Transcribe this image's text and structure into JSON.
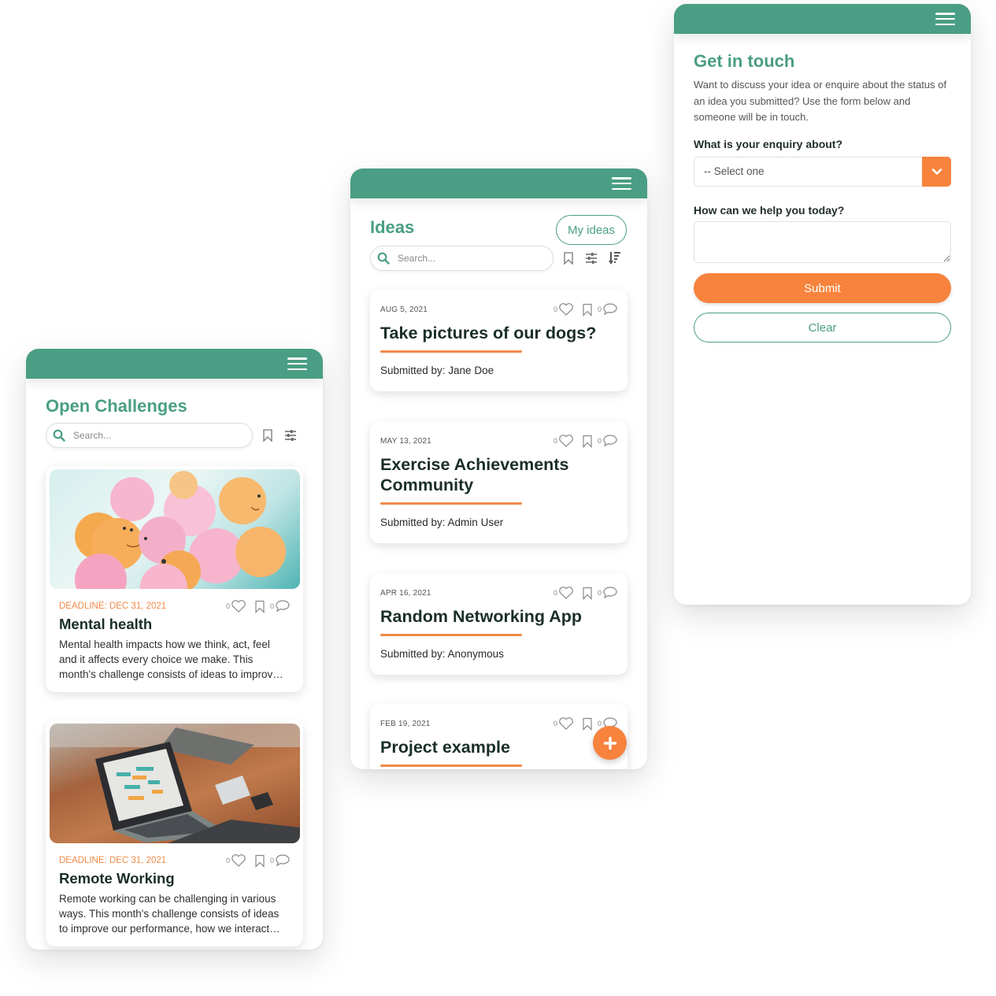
{
  "colors": {
    "brand_green": "#4a9e84",
    "accent_orange": "#f7833d",
    "underline_orange": "#f08a48"
  },
  "challenges_screen": {
    "title": "Open Challenges",
    "search_placeholder": "Search...",
    "cards": [
      {
        "image": "pink-and-orange-smiley-balloons-photo",
        "deadline": "DEADLINE: DEC 31, 2021",
        "likes": "0",
        "comments": "0",
        "title": "Mental health",
        "description": "Mental health impacts how we think, act, feel and it affects every choice we make. This month's challenge consists of ideas to improv…"
      },
      {
        "image": "laptop-on-leather-sofa-photo",
        "deadline": "DEADLINE: DEC 31, 2021",
        "likes": "0",
        "comments": "0",
        "title": "Remote Working",
        "description": "Remote working can be challenging in various ways. This month's challenge consists of ideas to improve our performance, how we interact…"
      }
    ]
  },
  "ideas_screen": {
    "title": "Ideas",
    "my_ideas_label": "My ideas",
    "search_placeholder": "Search...",
    "ideas": [
      {
        "date": "AUG 5, 2021",
        "likes": "0",
        "comments": "0",
        "title": "Take pictures of our dogs?",
        "submitted_by": "Submitted by: Jane Doe"
      },
      {
        "date": "MAY 13, 2021",
        "likes": "0",
        "comments": "0",
        "title": "Exercise Achievements Community",
        "submitted_by": "Submitted by: Admin User"
      },
      {
        "date": "APR 16, 2021",
        "likes": "0",
        "comments": "0",
        "title": "Random Networking App",
        "submitted_by": "Submitted by: Anonymous"
      },
      {
        "date": "FEB 19, 2021",
        "likes": "0",
        "comments": "0",
        "title": "Project example",
        "submitted_by": ""
      }
    ],
    "fab_icon": "plus-icon"
  },
  "contact_screen": {
    "title": "Get in touch",
    "intro": "Want to discuss your idea or enquire about the status of an idea you submitted? Use the form below and someone will be in touch.",
    "enquiry_label": "What is your enquiry about?",
    "enquiry_selected": "-- Select one",
    "help_label": "How can we help you today?",
    "help_value": "",
    "submit_label": "Submit",
    "clear_label": "Clear"
  }
}
